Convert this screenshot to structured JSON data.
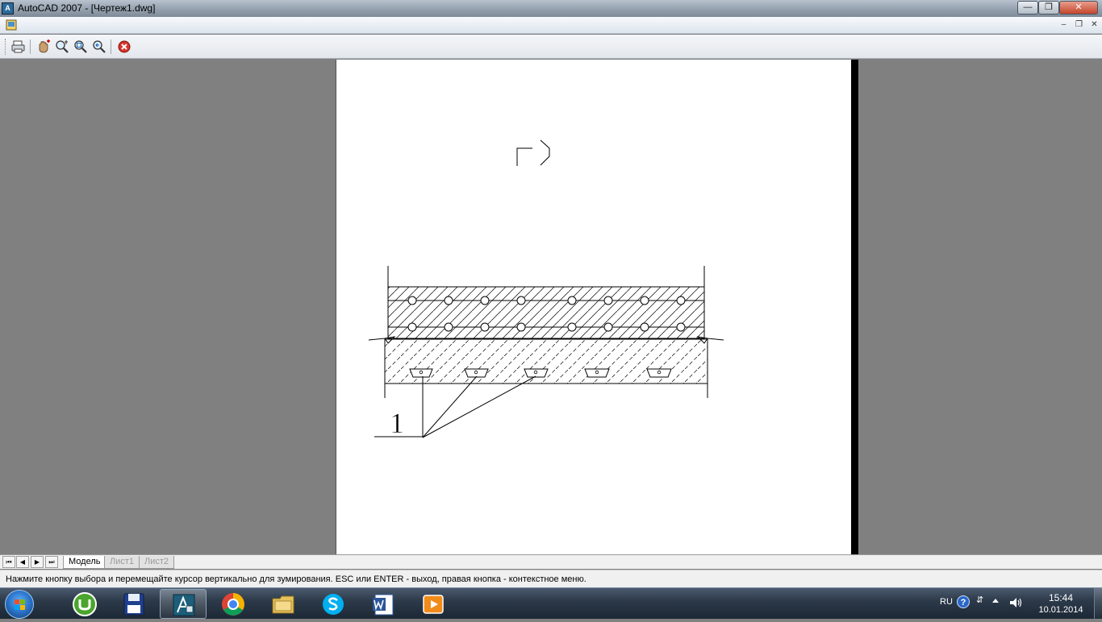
{
  "window": {
    "title": "AutoCAD 2007 - [Чертеж1.dwg]",
    "app_icon_label": "A",
    "minimize_glyph": "—",
    "maximize_glyph": "❐",
    "close_glyph": "✕"
  },
  "mdi_controls": {
    "minimize_glyph": "–",
    "restore_glyph": "❐",
    "close_glyph": "✕"
  },
  "toolbar": {
    "buttons": [
      {
        "icon": "plot-icon"
      },
      {
        "icon": "pan-icon"
      },
      {
        "icon": "zoom-realtime-icon"
      },
      {
        "icon": "zoom-window-icon"
      },
      {
        "icon": "zoom-previous-icon"
      },
      {
        "icon": "close-preview-icon"
      }
    ]
  },
  "drawing": {
    "section_label": "Г",
    "leader_label": "1"
  },
  "layout_tabs": {
    "nav": [
      "⏮",
      "◀",
      "▶",
      "⏭"
    ],
    "tabs": [
      {
        "label": "Модель",
        "active": true
      },
      {
        "label": "Лист1",
        "active": false
      },
      {
        "label": "Лист2",
        "active": false
      }
    ]
  },
  "status": {
    "prompt": "Нажмите кнопку выбора и перемещайте курсор вертикально для зумирования. ESC или ENTER - выход, правая кнопка - контекстное меню."
  },
  "taskbar": {
    "apps": [
      {
        "name": "utorrent",
        "open": false
      },
      {
        "name": "save-floppy",
        "open": false
      },
      {
        "name": "autocad",
        "open": true
      },
      {
        "name": "chrome",
        "open": false
      },
      {
        "name": "explorer",
        "open": false
      },
      {
        "name": "skype",
        "open": false
      },
      {
        "name": "word",
        "open": false
      },
      {
        "name": "media-player",
        "open": false
      }
    ],
    "tray": {
      "language": "RU",
      "help_glyph": "?",
      "network_glyph": "⇵"
    },
    "clock": {
      "time": "15:44",
      "date": "10.01.2014"
    }
  },
  "colors": {
    "viewport_bg": "#808080",
    "sheet_bg": "#ffffff",
    "close_red": "#c3452a"
  }
}
